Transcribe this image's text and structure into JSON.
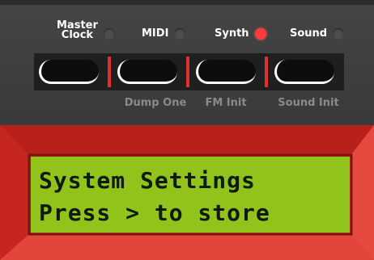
{
  "labels": {
    "master_clock_line1": "Master",
    "master_clock_line2": "Clock",
    "midi": "MIDI",
    "synth": "Synth",
    "sound": "Sound"
  },
  "leds": {
    "master_clock": "off",
    "midi": "off",
    "synth": "on",
    "sound": "off"
  },
  "sub_labels": {
    "dump_one": "Dump One",
    "fm_init": "FM Init",
    "sound_init": "Sound Init"
  },
  "display": {
    "line1": "System Settings",
    "line2": "Press > to store"
  },
  "colors": {
    "led_on": "#ff3b3b",
    "frame_red": "#d8322c",
    "lcd_green": "#92c31a"
  }
}
